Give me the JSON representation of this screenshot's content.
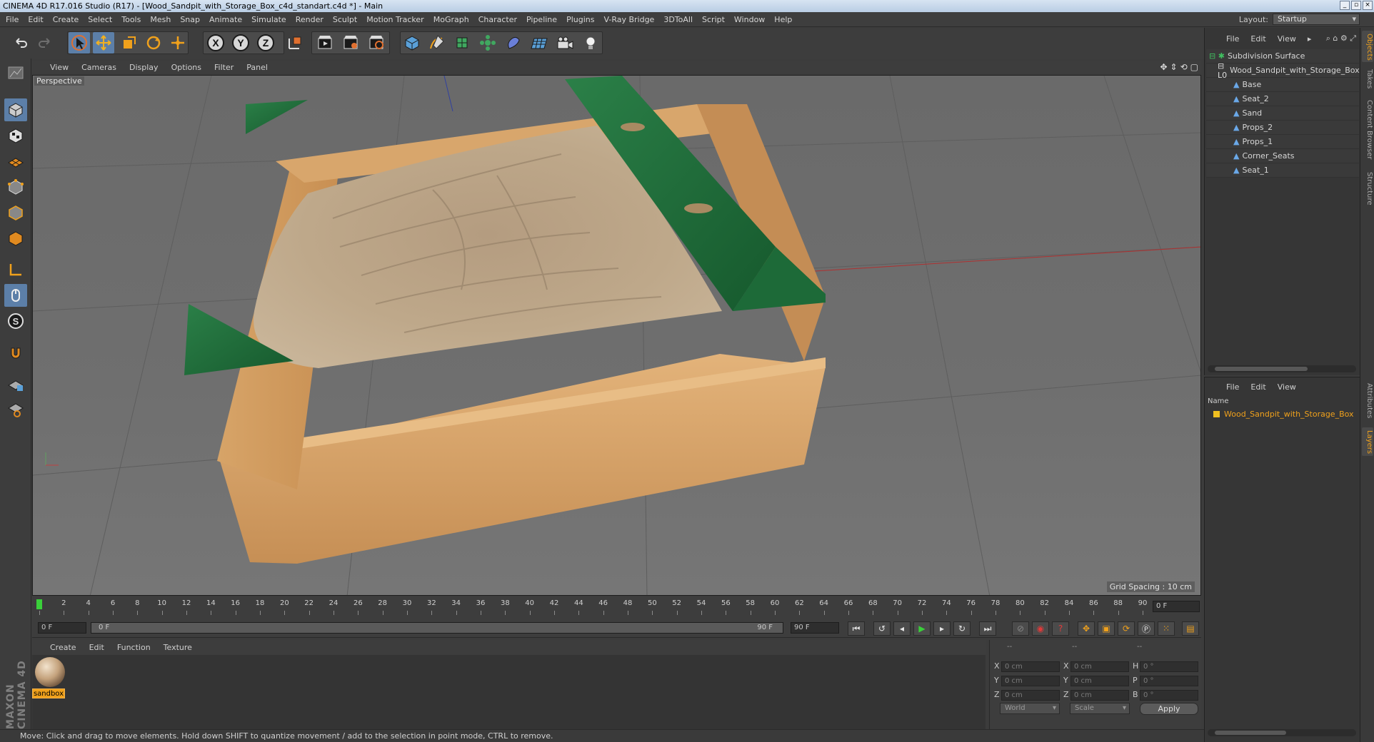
{
  "window": {
    "title": "CINEMA 4D R17.016 Studio (R17) - [Wood_Sandpit_with_Storage_Box_c4d_standart.c4d *] - Main",
    "buttons": [
      "_",
      "▫",
      "×"
    ]
  },
  "menubar": {
    "items": [
      "File",
      "Edit",
      "Create",
      "Select",
      "Tools",
      "Mesh",
      "Snap",
      "Animate",
      "Simulate",
      "Render",
      "Sculpt",
      "Motion Tracker",
      "MoGraph",
      "Character",
      "Pipeline",
      "Plugins",
      "V-Ray Bridge",
      "3DToAll",
      "Script",
      "Window",
      "Help"
    ],
    "layout_label": "Layout:",
    "layout_value": "Startup"
  },
  "toolbar": {
    "axis_x": "X",
    "axis_y": "Y",
    "axis_z": "Z"
  },
  "viewport": {
    "menu": [
      "View",
      "Cameras",
      "Display",
      "Options",
      "Filter",
      "Panel"
    ],
    "label": "Perspective",
    "grid_spacing": "Grid Spacing : 10 cm"
  },
  "timeline": {
    "ticks": [
      "0",
      "2",
      "4",
      "6",
      "8",
      "10",
      "12",
      "14",
      "16",
      "18",
      "20",
      "22",
      "24",
      "26",
      "28",
      "30",
      "32",
      "34",
      "36",
      "38",
      "40",
      "42",
      "44",
      "46",
      "48",
      "50",
      "52",
      "54",
      "56",
      "58",
      "60",
      "62",
      "64",
      "66",
      "68",
      "70",
      "72",
      "74",
      "76",
      "78",
      "80",
      "82",
      "84",
      "86",
      "88",
      "90"
    ],
    "current_frame": "0 F"
  },
  "transport": {
    "start_field": "0 F",
    "slider_start": "0 F",
    "slider_end": "90 F",
    "end_field": "90 F"
  },
  "materials": {
    "menu": [
      "Create",
      "Edit",
      "Function",
      "Texture"
    ],
    "items": [
      {
        "name": "sandbox"
      }
    ],
    "brand": "MAXON CINEMA 4D"
  },
  "coordinates": {
    "headers": [
      "--",
      "--",
      "--"
    ],
    "rows": [
      {
        "pos_label": "X",
        "pos": "0 cm",
        "size_label": "X",
        "size": "0 cm",
        "rot_label": "H",
        "rot": "0 °"
      },
      {
        "pos_label": "Y",
        "pos": "0 cm",
        "size_label": "Y",
        "size": "0 cm",
        "rot_label": "P",
        "rot": "0 °"
      },
      {
        "pos_label": "Z",
        "pos": "0 cm",
        "size_label": "Z",
        "size": "0 cm",
        "rot_label": "B",
        "rot": "0 °"
      }
    ],
    "mode_world": "World",
    "mode_scale": "Scale",
    "apply": "Apply"
  },
  "status": {
    "text": "Move: Click and drag to move elements. Hold down SHIFT to quantize movement / add to the selection in point mode, CTRL to remove."
  },
  "objects": {
    "menu": [
      "File",
      "Edit",
      "View"
    ],
    "tree": [
      {
        "name": "Subdivision Surface",
        "indent": 0
      },
      {
        "name": "Wood_Sandpit_with_Storage_Box",
        "indent": 1
      },
      {
        "name": "Base",
        "indent": 2
      },
      {
        "name": "Seat_2",
        "indent": 2
      },
      {
        "name": "Sand",
        "indent": 2
      },
      {
        "name": "Props_2",
        "indent": 2
      },
      {
        "name": "Props_1",
        "indent": 2
      },
      {
        "name": "Corner_Seats",
        "indent": 2
      },
      {
        "name": "Seat_1",
        "indent": 2
      }
    ]
  },
  "layers": {
    "menu": [
      "File",
      "Edit",
      "View"
    ],
    "name_header": "Name",
    "row": "Wood_Sandpit_with_Storage_Box"
  },
  "side_tabs": [
    "Objects",
    "Takes",
    "Content Browser",
    "Structure",
    "Attributes",
    "Layers"
  ],
  "colors": {
    "accent": "#f0a11c",
    "selection_blue": "#5c7fa8",
    "wood": "#d9a56a",
    "green": "#1e6b3a",
    "sand": "#b9a386"
  }
}
